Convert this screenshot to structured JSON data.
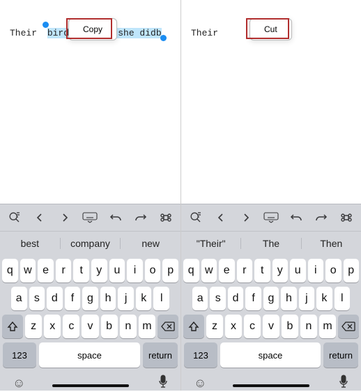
{
  "left": {
    "text_plain": "Their ",
    "text_selected": "bird  bhi           ohi she didb",
    "popup_label": "Copy",
    "suggestions": [
      "best",
      "company",
      "new"
    ]
  },
  "right": {
    "text_plain": "Their",
    "popup_label": "Cut",
    "suggestions": [
      "\"Their\"",
      "The",
      "Then"
    ]
  },
  "keyboard": {
    "row1": [
      "q",
      "w",
      "e",
      "r",
      "t",
      "y",
      "u",
      "i",
      "o",
      "p"
    ],
    "row2": [
      "a",
      "s",
      "d",
      "f",
      "g",
      "h",
      "j",
      "k",
      "l"
    ],
    "row3": [
      "z",
      "x",
      "c",
      "v",
      "b",
      "n",
      "m"
    ],
    "num_label": "123",
    "space_label": "space",
    "return_label": "return"
  }
}
